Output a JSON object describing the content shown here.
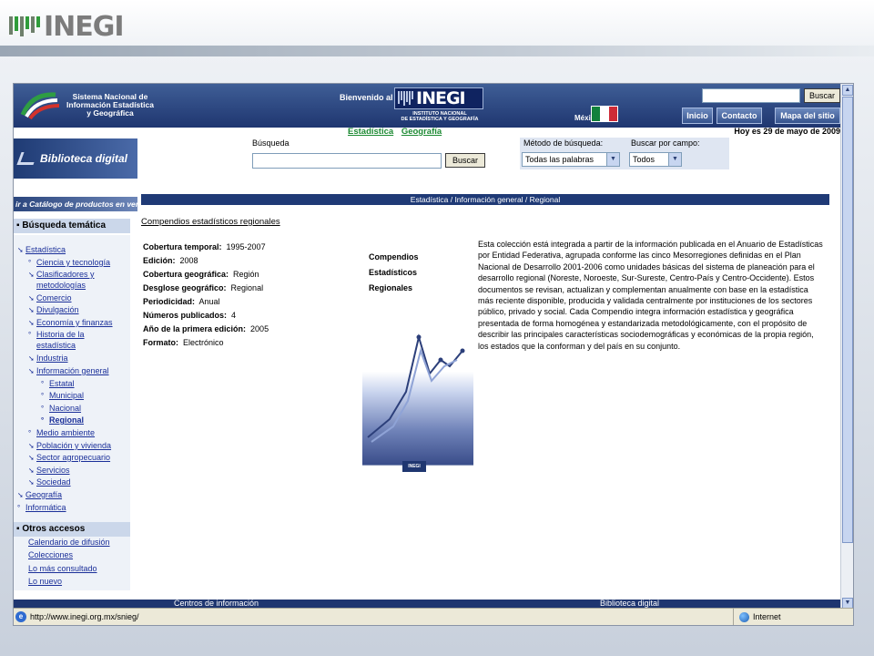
{
  "slide": {
    "logo_text": "INEGI"
  },
  "header": {
    "sn_line1": "Sistema Nacional de",
    "sn_line2": "Información Estadística",
    "sn_line3": "y Geográfica",
    "welcome": "Bienvenido al",
    "inegi": "INEGI",
    "inegi_sub1": "INSTITUTO NACIONAL",
    "inegi_sub2": "DE ESTADÍSTICA Y GEOGRAFÍA",
    "mexico": "México",
    "search_button": "Buscar",
    "tabs": [
      "Inicio",
      "Contacto",
      "Mapa del sitio"
    ]
  },
  "subnav": {
    "links": [
      "Estadística",
      "Geografía"
    ],
    "date": "Hoy es 29 de mayo de 2009"
  },
  "biblioteca": "Biblioteca digital",
  "search": {
    "label": "Búsqueda",
    "button": "Buscar",
    "method_label": "Método de búsqueda:",
    "method_value": "Todas las palabras",
    "field_label": "Buscar por campo:",
    "field_value": "Todos"
  },
  "sidebar": {
    "catalog": "ir a Catálogo de productos en venta",
    "tematica": "Búsqueda temática",
    "items": [
      "Estadística",
      "Ciencia y tecnología",
      "Clasificadores y",
      "metodologías",
      "Comercio",
      "Divulgación",
      "Economía y finanzas",
      "Historia de la",
      "estadística",
      "Industria",
      "Información general",
      "Estatal",
      "Municipal",
      "Nacional",
      "Regional",
      "Medio ambiente",
      "Población y vivienda",
      "Sector agropecuario",
      "Servicios",
      "Sociedad",
      "Geografía",
      "Informática"
    ],
    "otros": "Otros accesos",
    "accesos": [
      "Calendario de difusión",
      "Colecciones",
      "Lo más consultado",
      "Lo nuevo"
    ]
  },
  "content": {
    "breadcrumb": "Estadística / Información general / Regional",
    "title": "Compendios estadísticos regionales",
    "meta": [
      {
        "label": "Cobertura temporal:",
        "value": "1995-2007"
      },
      {
        "label": "Edición:",
        "value": "2008"
      },
      {
        "label": "Cobertura geográfica:",
        "value": "Región"
      },
      {
        "label": "Desglose geográfico:",
        "value": "Regional"
      },
      {
        "label": "Periodicidad:",
        "value": "Anual"
      },
      {
        "label": "Números publicados:",
        "value": "4"
      },
      {
        "label": "Año de la primera edición:",
        "value": "2005"
      },
      {
        "label": "Formato:",
        "value": "Electrónico"
      }
    ],
    "cover_title_1": "Compendios",
    "cover_title_2": "Estadísticos",
    "cover_title_3": "Regionales",
    "cover_logo": "INEGI",
    "description": "Esta colección está integrada a partir de la información publicada en el Anuario de Estadísticas por Entidad Federativa, agrupada conforme las cinco Mesorregiones definidas en el Plan Nacional de Desarrollo 2001-2006 como unidades básicas del sistema de planeación para el desarrollo regional (Noreste, Noroeste, Sur-Sureste, Centro-País y Centro-Occidente). Estos documentos se revisan, actualizan y complementan anualmente con base en la estadística más reciente disponible, producida y validada centralmente por instituciones de los sectores público, privado y social. Cada Compendio integra información estadística y geográfica presentada de forma homogénea y estandarizada metodológicamente, con el propósito de describir las principales características sociodemográficas y económicas de la propia región, los estados que la conforman y del país en su conjunto."
  },
  "footer": {
    "left": "Centros de información",
    "right": "Biblioteca digital"
  },
  "status": {
    "url": "http://www.inegi.org.mx/snieg/",
    "zone": "Internet"
  },
  "colors": {
    "header_blue": "#1f3670",
    "link_green": "#1d8a33",
    "link_blue": "#1a2f99"
  }
}
